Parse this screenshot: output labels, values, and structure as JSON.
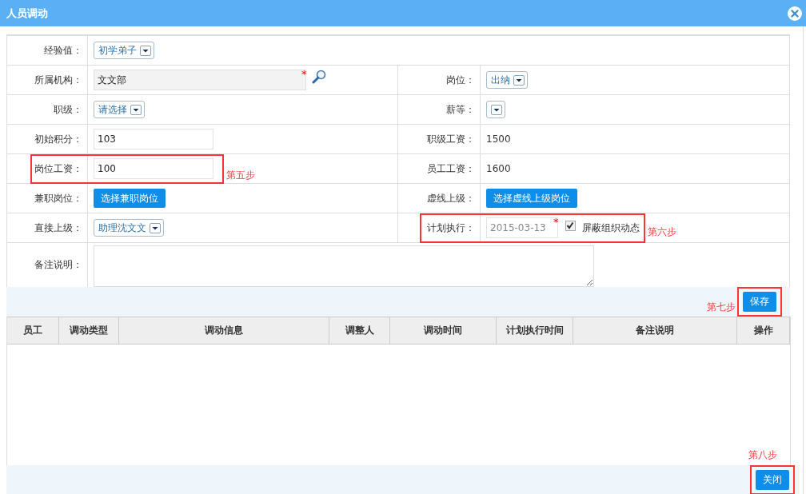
{
  "window": {
    "title": "人员调动"
  },
  "form_rows": [
    {
      "fields": [
        {
          "label": "经验值：",
          "kind": "select",
          "value": "初学弟子"
        }
      ]
    },
    {
      "fields": [
        {
          "label": "所属机构：",
          "kind": "lookup",
          "value": "文文部",
          "required_mark": "*"
        },
        {
          "label": "岗位：",
          "kind": "select",
          "value": "出纳"
        }
      ]
    },
    {
      "fields": [
        {
          "label": "职级：",
          "kind": "select",
          "value": "请选择"
        },
        {
          "label": "薪等：",
          "kind": "select"
        }
      ]
    },
    {
      "fields": [
        {
          "label": "初始积分：",
          "kind": "input",
          "value": "103"
        },
        {
          "label": "职级工资：",
          "kind": "text",
          "value": "1500"
        }
      ]
    },
    {
      "fields": [
        {
          "label": "岗位工资：",
          "kind": "input",
          "value": "100",
          "highlighted": true,
          "step": "第五步"
        },
        {
          "label": "员工工资：",
          "kind": "text",
          "value": "1600"
        }
      ]
    },
    {
      "fields": [
        {
          "label": "兼职岗位：",
          "kind": "button",
          "value": "选择兼职岗位"
        },
        {
          "label": "虚线上级：",
          "kind": "button",
          "value": "选择虚线上级岗位"
        }
      ]
    },
    {
      "fields": [
        {
          "label": "直接上级：",
          "kind": "select",
          "value": "助理沈文文"
        },
        {
          "label": "计划执行：",
          "kind": "date",
          "value": "2015-03-13",
          "required_mark": "*",
          "checkbox": {
            "label": "屏蔽组织动态",
            "checked": true
          },
          "highlighted": true,
          "step": "第六步"
        }
      ]
    },
    {
      "fields": [
        {
          "label": "备注说明：",
          "kind": "textarea"
        }
      ]
    }
  ],
  "save": {
    "label": "保存",
    "highlighted": true,
    "step": "第七步"
  },
  "table": {
    "columns": [
      "员工",
      "调动类型",
      "调动信息",
      "调整人",
      "调动时间",
      "计划执行时间",
      "备注说明",
      "操作"
    ]
  },
  "close": {
    "label": "关闭",
    "highlighted": true,
    "step": "第八步"
  }
}
